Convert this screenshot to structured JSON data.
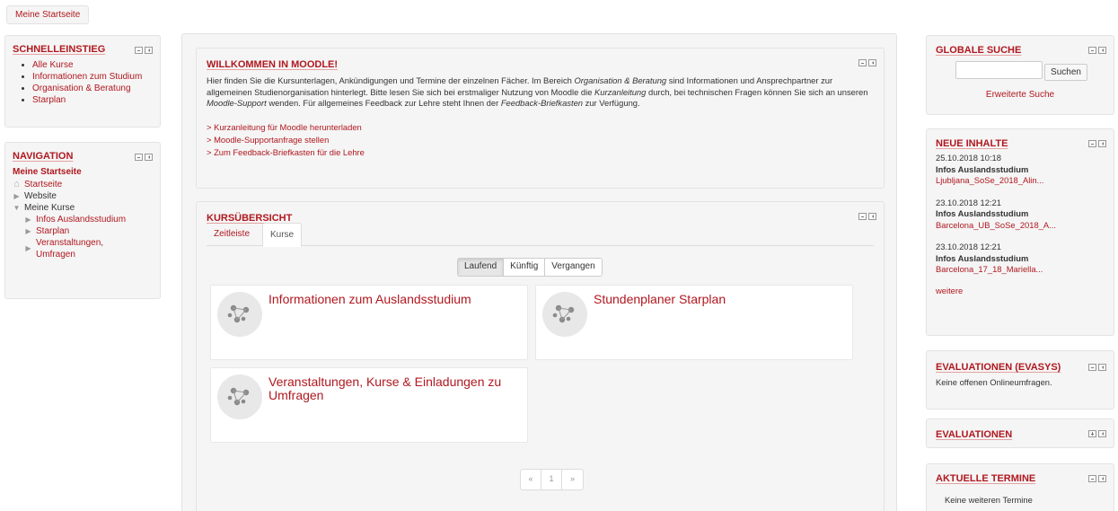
{
  "breadcrumb": {
    "home_label": "Meine Startseite"
  },
  "schnelleinstieg": {
    "title": "SCHNELLEINSTIEG",
    "items": [
      "Alle Kurse",
      "Informationen zum Studium",
      "Organisation & Beratung",
      "Starplan"
    ]
  },
  "navigation": {
    "title": "NAVIGATION",
    "current": "Meine Startseite",
    "items": {
      "startseite": "Startseite",
      "website": "Website",
      "meine_kurse": "Meine Kurse",
      "infos": "Infos Auslandsstudium",
      "starplan": "Starplan",
      "veranstaltungen_1": "Veranstaltungen,",
      "veranstaltungen_2": "Umfragen"
    }
  },
  "welcome": {
    "title": "WILLKOMMEN IN MOODLE!",
    "p1": "Hier finden Sie die Kursunterlagen, Ankündigungen und Termine der einzelnen Fächer. Im Bereich ",
    "p1_em": "Organisation & Beratung",
    "p2": " sind Informationen und Ansprechpartner zur allgemeinen Studienorganisation hinterlegt. Bitte lesen Sie sich bei erstmaliger Nutzung von Moodle die ",
    "p2_em": "Kurzanleitung",
    "p3": " durch, bei technischen Fragen können Sie sich an unseren ",
    "p3_em": "Moodle-Support",
    "p4": " wenden. Für allgemeines Feedback zur Lehre steht Ihnen der ",
    "p4_em": "Feedback-Briefkasten",
    "p5": " zur Verfügung.",
    "links": [
      "> Kurzanleitung für Moodle herunterladen",
      "> Moodle-Supportanfrage stellen",
      "> Zum Feedback-Briefkasten für die Lehre"
    ]
  },
  "kursuebersicht": {
    "title": "KURSÜBERSICHT",
    "tabs": [
      "Zeitleiste",
      "Kurse"
    ],
    "filters": [
      "Laufend",
      "Künftig",
      "Vergangen"
    ],
    "courses": [
      "Informationen zum Auslandsstudium",
      "Stundenplaner Starplan",
      "Veranstaltungen, Kurse & Einladungen zu Umfragen"
    ],
    "pager": [
      "«",
      "1",
      "»"
    ]
  },
  "search": {
    "title": "GLOBALE SUCHE",
    "button": "Suchen",
    "advanced": "Erweiterte Suche",
    "value": ""
  },
  "news": {
    "title": "NEUE INHALTE",
    "items": [
      {
        "date": "25.10.2018 10:18",
        "course": "Infos Auslandsstudium",
        "file": "Ljubljana_SoSe_2018_Alin..."
      },
      {
        "date": "23.10.2018 12:21",
        "course": "Infos Auslandsstudium",
        "file": "Barcelona_UB_SoSe_2018_A..."
      },
      {
        "date": "23.10.2018 12:21",
        "course": "Infos Auslandsstudium",
        "file": "Barcelona_17_18_Mariella..."
      }
    ],
    "more": "weitere"
  },
  "evasys": {
    "title": "EVALUATIONEN (EVASYS)",
    "text": "Keine offenen Onlineumfragen."
  },
  "evaluationen": {
    "title": "EVALUATIONEN"
  },
  "termine": {
    "title": "AKTUELLE TERMINE",
    "text": "Keine weiteren Termine"
  },
  "colors": {
    "accent": "#b0181f",
    "block_bg": "#f5f5f5",
    "border": "#e3e3e3"
  }
}
